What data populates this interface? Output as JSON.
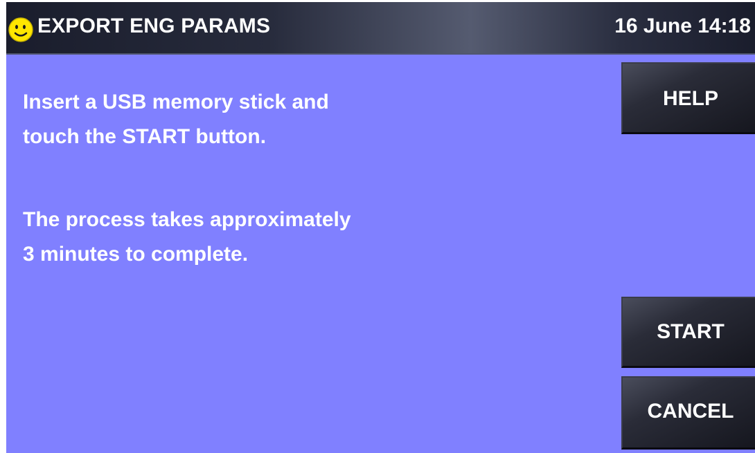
{
  "header": {
    "title": "EXPORT ENG PARAMS",
    "datetime": "16 June 14:18",
    "status_icon": "smiley-face-icon",
    "status_icon_color": "#ffe600"
  },
  "colors": {
    "screen_background": "#8080ff",
    "header_background": "#1a1d2c",
    "text": "#ffffff"
  },
  "message": {
    "instruction_lines": [
      "Insert a USB memory stick and",
      "touch the START button."
    ],
    "duration_lines": [
      "The process takes approximately",
      "3 minutes to complete."
    ]
  },
  "buttons": {
    "help": "HELP",
    "start": "START",
    "cancel": "CANCEL"
  }
}
